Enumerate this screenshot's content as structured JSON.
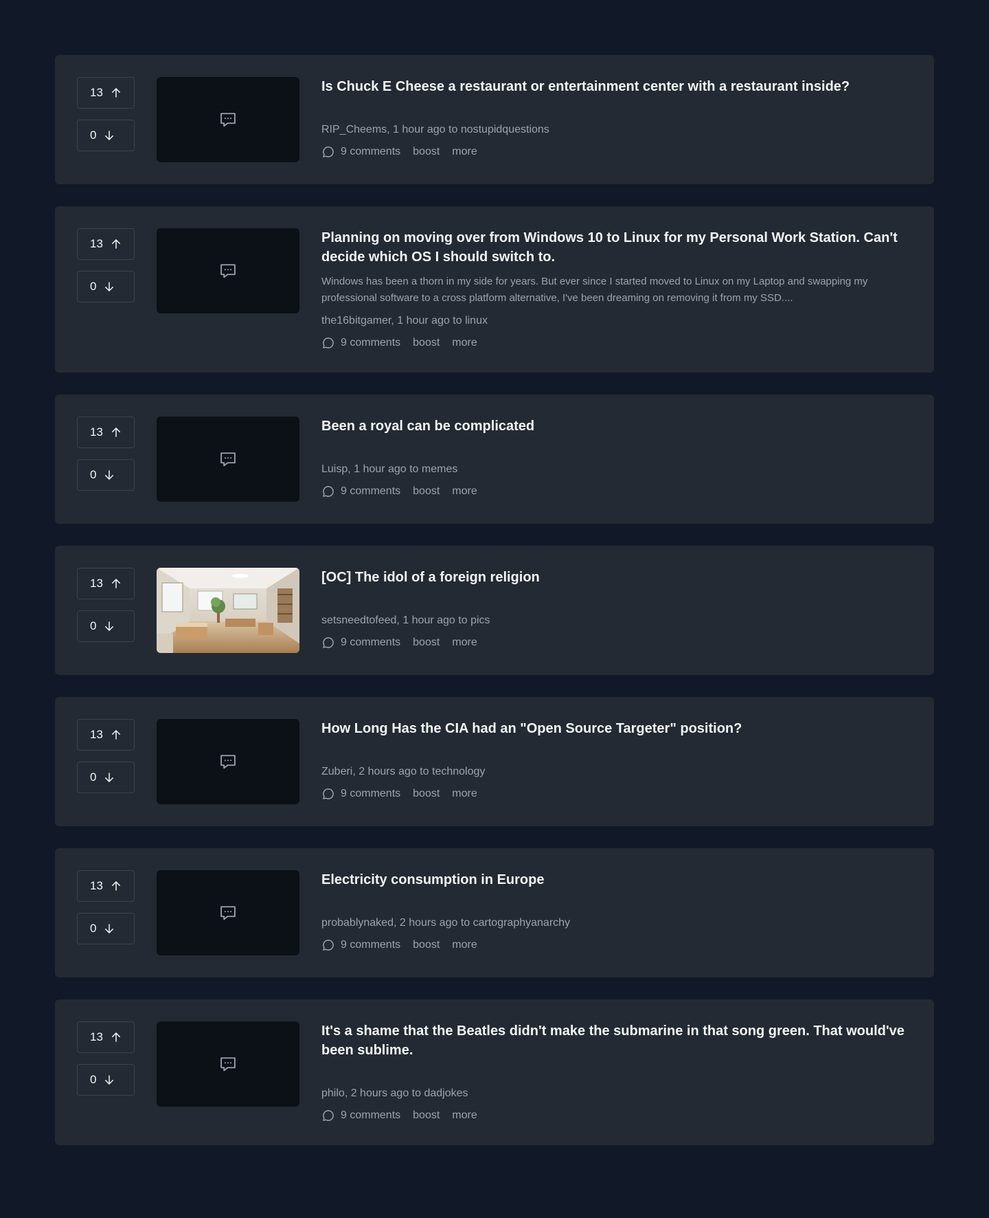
{
  "posts": [
    {
      "upvotes": "13",
      "downvotes": "0",
      "thumbnail": "chat-icon",
      "title": "Is Chuck E Cheese a restaurant or entertainment center with a restaurant inside?",
      "excerpt": "",
      "author": "RIP_Cheems",
      "time": "1 hour ago",
      "to": "to",
      "community": "nostupidquestions",
      "comments": "9 comments",
      "boost": "boost",
      "more": "more"
    },
    {
      "upvotes": "13",
      "downvotes": "0",
      "thumbnail": "chat-icon",
      "title": "Planning on moving over from Windows 10 to Linux for my Personal Work Station. Can't decide which OS I should switch to.",
      "excerpt": "Windows has been a thorn in my side for years. But ever since I started moved to Linux on my Laptop and swapping my professional software to a cross platform alternative, I've been dreaming on removing it from my SSD....",
      "author": "the16bitgamer",
      "time": "1 hour ago",
      "to": "to",
      "community": "linux",
      "comments": "9 comments",
      "boost": "boost",
      "more": "more"
    },
    {
      "upvotes": "13",
      "downvotes": "0",
      "thumbnail": "chat-icon",
      "title": "Been a royal can be complicated",
      "excerpt": "",
      "author": "Luisp",
      "time": "1 hour ago",
      "to": "to",
      "community": "memes",
      "comments": "9 comments",
      "boost": "boost",
      "more": "more"
    },
    {
      "upvotes": "13",
      "downvotes": "0",
      "thumbnail": "office-photo",
      "title": "[OC] The idol of a foreign religion",
      "excerpt": "",
      "author": "setsneedtofeed",
      "time": "1 hour ago",
      "to": "to",
      "community": "pics",
      "comments": "9 comments",
      "boost": "boost",
      "more": "more"
    },
    {
      "upvotes": "13",
      "downvotes": "0",
      "thumbnail": "chat-icon",
      "title": "How Long Has the CIA had an \"Open Source Targeter\" position?",
      "excerpt": "",
      "author": "Zuberi",
      "time": "2 hours ago",
      "to": "to",
      "community": "technology",
      "comments": "9 comments",
      "boost": "boost",
      "more": "more"
    },
    {
      "upvotes": "13",
      "downvotes": "0",
      "thumbnail": "chat-icon",
      "title": "Electricity consumption in Europe",
      "excerpt": "",
      "author": "probablynaked",
      "time": "2 hours ago",
      "to": "to",
      "community": "cartographyanarchy",
      "comments": "9 comments",
      "boost": "boost",
      "more": "more"
    },
    {
      "upvotes": "13",
      "downvotes": "0",
      "thumbnail": "chat-icon",
      "title": "It's a shame that the Beatles didn't make the submarine in that song green. That would've been sublime.",
      "excerpt": "",
      "author": "philo",
      "time": "2 hours ago",
      "to": "to",
      "community": "dadjokes",
      "comments": "9 comments",
      "boost": "boost",
      "more": "more"
    }
  ],
  "colors": {
    "page_bg": "#111827",
    "card_bg": "#232a33",
    "thumb_bg": "#0c1017",
    "text_primary": "#f3f4f6",
    "text_muted": "#9ca3af",
    "border": "#3b434e"
  }
}
